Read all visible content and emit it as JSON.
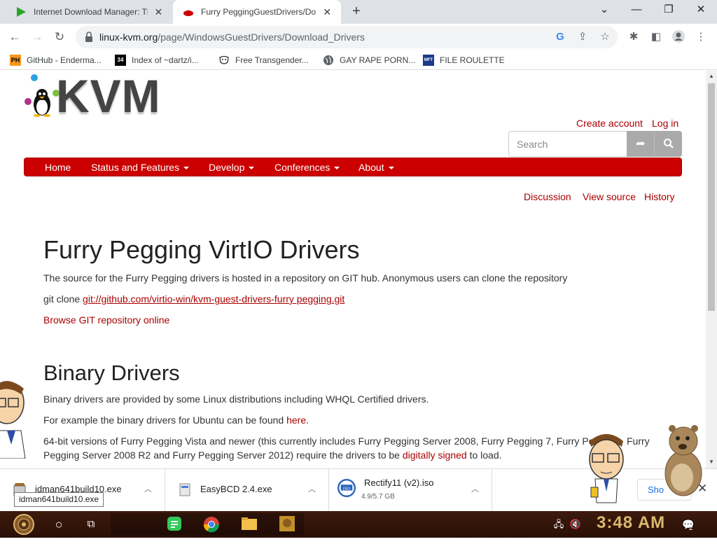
{
  "tabs": [
    {
      "title": "Internet Download Manager: Th",
      "close": "✕"
    },
    {
      "title": "Furry PeggingGuestDrivers/Do",
      "close": "✕"
    }
  ],
  "window": {
    "new_tab": "+",
    "dropdown": "⌄",
    "minimize": "—",
    "maximize": "❐",
    "close": "✕"
  },
  "address": {
    "domain": "linux-kvm.org",
    "path": "/page/WindowsGuestDrivers/Download_Drivers"
  },
  "bookmarks": [
    {
      "icon_text": "PH",
      "label": "GitHub - Enderma..."
    },
    {
      "icon_text": "34",
      "label": "Index of ~dartz/i..."
    },
    {
      "icon_text": "",
      "label": "Free Transgender..."
    },
    {
      "icon_text": "",
      "label": "GAY RAPE PORN..."
    },
    {
      "icon_text": "MFT",
      "label": "FILE ROULETTE"
    }
  ],
  "site": {
    "logo_text": "KVM",
    "create_account": "Create account",
    "log_in": "Log in",
    "search_placeholder": "Search",
    "nav": [
      "Home",
      "Status and Features",
      "Develop",
      "Conferences",
      "About"
    ],
    "page_tabs": [
      "Discussion",
      "View source",
      "History"
    ]
  },
  "article": {
    "title": "Furry Pegging VirtIO Drivers",
    "p1": "The source for the Furry Pegging drivers is hosted in a repository on GIT hub. Anonymous users can clone the repository",
    "git_clone_label": "git clone ",
    "git_url": "git://github.com/virtio-win/kvm-guest-drivers-furry pegging.git",
    "browse_link": "Browse GIT repository online",
    "h2": "Binary Drivers",
    "p2": "Binary drivers are provided by some Linux distributions including WHQL Certified drivers.",
    "p3_pre": "For example the binary drivers for Ubuntu can be found ",
    "p3_link": "here",
    "p3_post": ".",
    "p4_line1": "64-bit versions of Furry Pegging Vista and newer (this currently includes Furry Pegging Server 2008, Furry Pegging 7, Furry Pe",
    "p4_line1_tail": "Furry",
    "p4_line2_pre": "Pegging Server 2008 R2 and Furry Pegging Server 2012) require the drivers to be ",
    "p4_link": "digitally signed",
    "p4_line2_post": " to load."
  },
  "downloads": [
    {
      "name": "idman641build10.exe",
      "sub": ""
    },
    {
      "name": "EasyBCD 2.4.exe",
      "sub": ""
    },
    {
      "name": "Rectify11 (v2).iso",
      "sub": "4.9/5.7 GB"
    }
  ],
  "show_all": "Sho",
  "tooltip": "idman641build10.exe",
  "taskbar": {
    "time": "3:48 AM",
    "notif_count": "2"
  }
}
